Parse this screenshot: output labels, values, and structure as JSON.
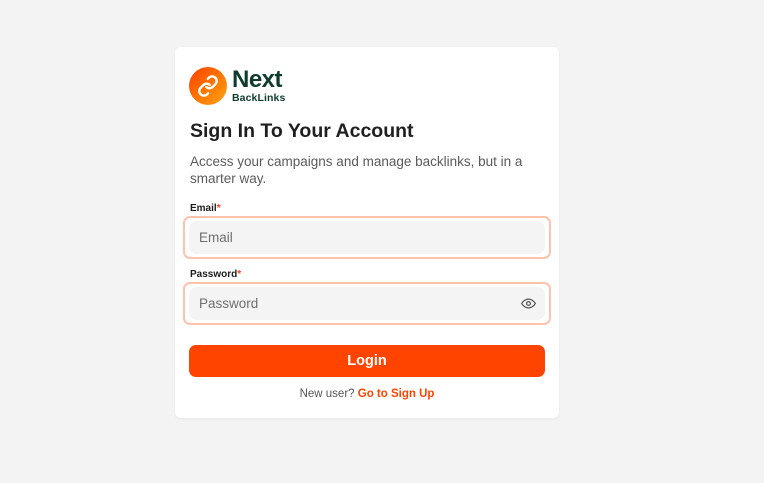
{
  "brand": {
    "name": "Next",
    "sub": "BackLinks",
    "icon": "link-icon",
    "accent": "#ff4400",
    "dark": "#0e3b2c"
  },
  "heading": {
    "title": "Sign In To Your Account",
    "subtitle": "Access your campaigns and manage backlinks, but in a smarter way."
  },
  "form": {
    "email": {
      "label": "Email",
      "required_mark": "*",
      "placeholder": "Email",
      "value": ""
    },
    "password": {
      "label": "Password",
      "required_mark": "*",
      "placeholder": "Password",
      "value": "",
      "toggle_icon": "eye-icon"
    },
    "submit_label": "Login"
  },
  "footer": {
    "prompt": "New user?",
    "link_label": "Go to Sign Up"
  }
}
